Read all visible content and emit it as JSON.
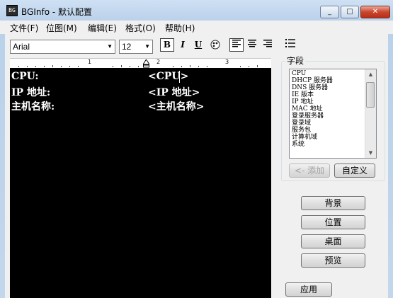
{
  "window": {
    "title": "BGInfo - 默认配置",
    "app_icon": "bginfo-app-icon",
    "minimize": "_",
    "maximize": "□",
    "close": "✕"
  },
  "menu": [
    "文件(F)",
    "位图(M)",
    "编辑(E)",
    "格式(O)",
    "帮助(H)"
  ],
  "toolbar": {
    "font": "Arial",
    "size": "12",
    "bold": "B",
    "italic": "I",
    "underline": "U",
    "align_left_icon": "align-left-icon",
    "align_center_icon": "align-center-icon",
    "align_right_icon": "align-right-icon",
    "bullets_icon": "bullets-icon"
  },
  "ruler": {
    "numbers": [
      "1",
      "2",
      "3"
    ]
  },
  "editor": {
    "rows": [
      {
        "label": "CPU:",
        "value": "<CPU>"
      },
      {
        "label": "IP 地址:",
        "value": "<IP 地址>"
      },
      {
        "label": "主机名称:",
        "value": "<主机名称>"
      }
    ]
  },
  "fields": {
    "title": "字段",
    "items": [
      "CPU",
      "DHCP 服务器",
      "DNS 服务器",
      "IE 版本",
      "IP 地址",
      "MAC 地址",
      "登录服务器",
      "登录域",
      "服务包",
      "计算机域",
      "系统"
    ],
    "add": "<- 添加",
    "custom": "自定义"
  },
  "buttons": {
    "background": "背景",
    "position": "位置",
    "desktop": "桌面",
    "preview": "预览",
    "apply": "应用"
  }
}
